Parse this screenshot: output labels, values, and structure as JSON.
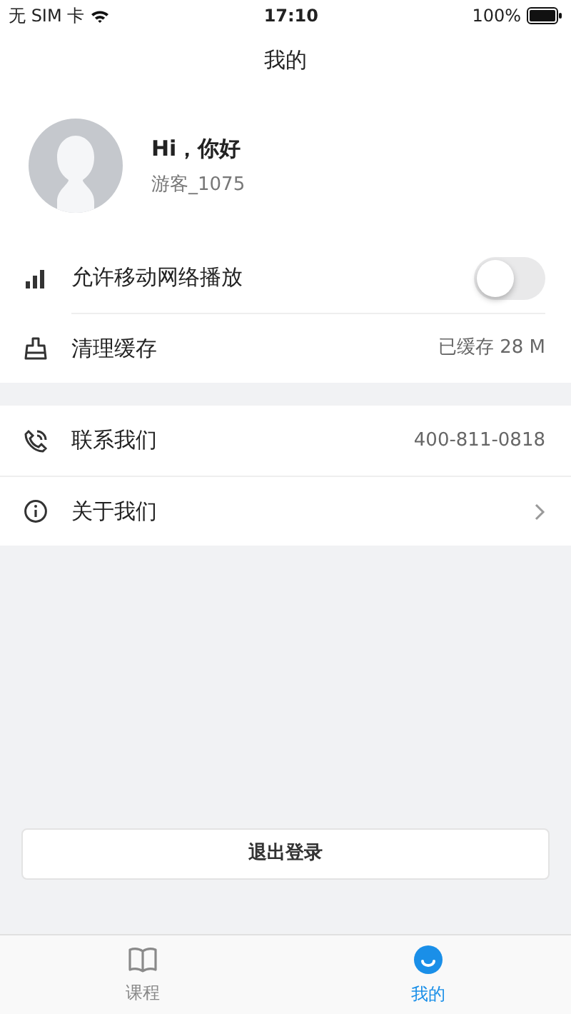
{
  "status_bar": {
    "carrier": "无 SIM 卡",
    "time": "17:10",
    "battery": "100%"
  },
  "nav_title": "我的",
  "profile": {
    "greeting": "Hi，你好",
    "username": "游客_1075"
  },
  "groups": [
    {
      "rows": [
        {
          "kind": "toggle",
          "label": "允许移动网络播放",
          "on": false
        },
        {
          "kind": "value",
          "label": "清理缓存",
          "value": "已缓存 28 M"
        }
      ]
    },
    {
      "rows": [
        {
          "kind": "value",
          "label": "联系我们",
          "value": "400-811-0818"
        },
        {
          "kind": "link",
          "label": "关于我们"
        }
      ]
    }
  ],
  "logout_button": "退出登录",
  "tabs": [
    {
      "label": "课程",
      "selected": false
    },
    {
      "label": "我的",
      "selected": true
    }
  ]
}
